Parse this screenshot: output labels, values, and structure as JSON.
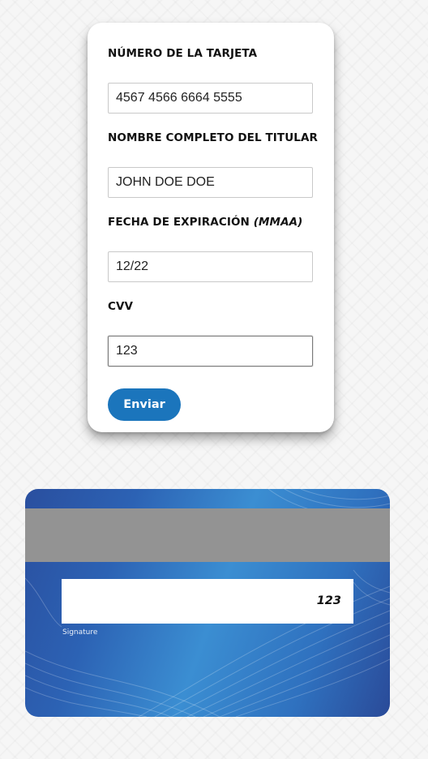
{
  "form": {
    "card_number": {
      "label": "NÚMERO DE LA TARJETA",
      "value": "4567 4566 6664 5555"
    },
    "holder_name": {
      "label": "NOMBRE COMPLETO DEL TITULAR",
      "value": "JOHN DOE DOE"
    },
    "expiry": {
      "label": "FECHA DE EXPIRACIÓN",
      "label_hint": "(MMAA)",
      "value": "12/22"
    },
    "cvv": {
      "label": "CVV",
      "value": "123"
    },
    "submit_label": "Enviar"
  },
  "card_back": {
    "cvv": "123",
    "signature_label": "Signature"
  },
  "colors": {
    "accent": "#1b75bc",
    "card_blue": "#2c62b4",
    "mag_stripe": "#939393"
  }
}
